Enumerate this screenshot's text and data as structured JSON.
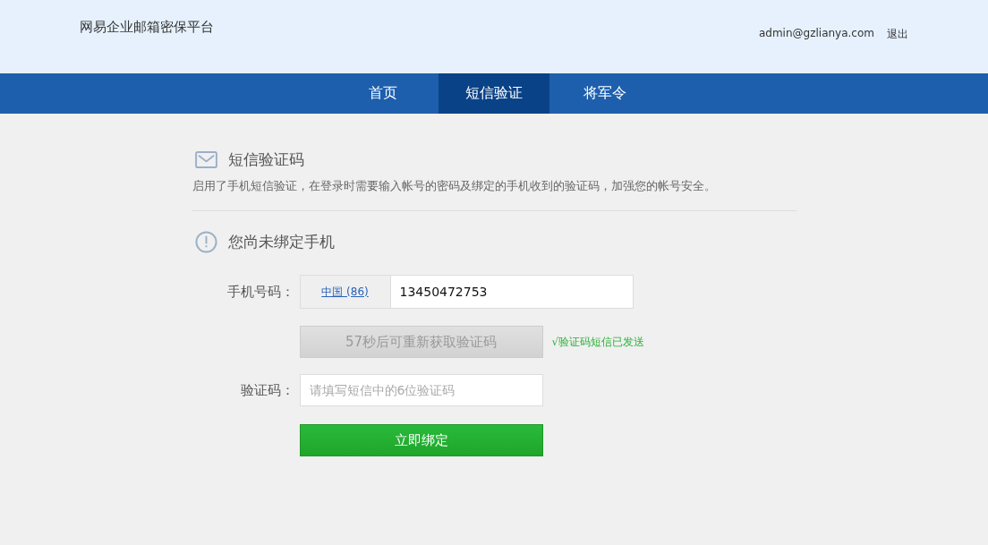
{
  "header": {
    "title": "网易企业邮箱密保平台",
    "user": "admin@gzlianya.com",
    "logout": "退出"
  },
  "tabs": [
    {
      "label": "首页",
      "selected": false
    },
    {
      "label": "短信验证",
      "selected": true
    },
    {
      "label": "将军令",
      "selected": false
    }
  ],
  "section": {
    "title": "短信验证码",
    "description": "启用了手机短信验证，在登录时需要输入帐号的密码及绑定的手机收到的验证码，加强您的帐号安全。"
  },
  "status": {
    "title": "您尚未绑定手机"
  },
  "form": {
    "phone_label": "手机号码：",
    "country": "中国 (86)",
    "phone_value": "13450472753",
    "resend_button": {
      "label": "57秒后可重新获取验证码",
      "disabled": true
    },
    "sent_notice": "√验证码短信已发送",
    "code_label": "验证码：",
    "code_placeholder": "请填写短信中的6位验证码",
    "submit": "立即绑定"
  }
}
